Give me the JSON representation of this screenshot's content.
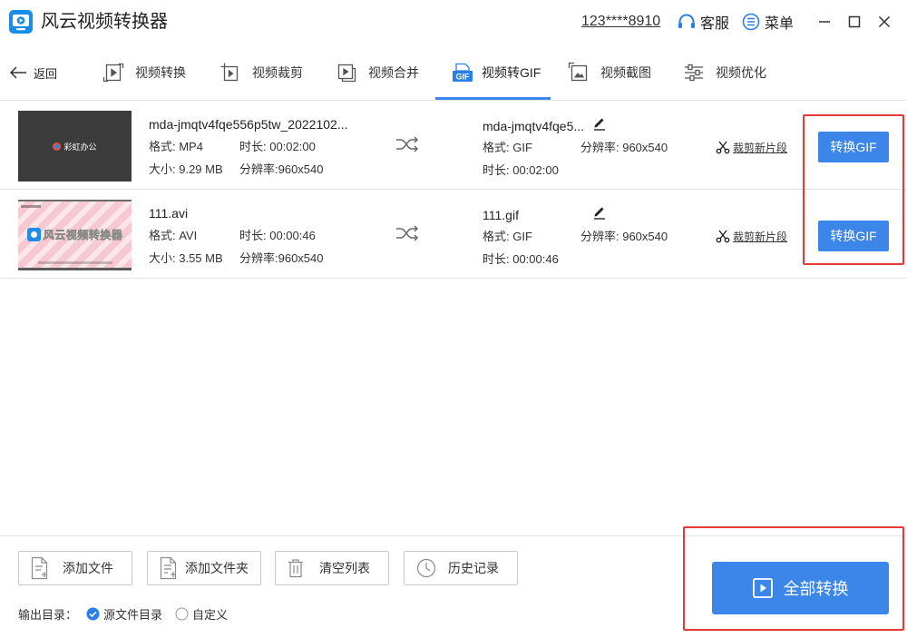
{
  "app": {
    "title": "风云视频转换器",
    "account": "123****8910",
    "support_label": "客服",
    "menu_label": "菜单"
  },
  "nav": {
    "back_label": "返回",
    "tabs": [
      {
        "label": "视频转换",
        "icon": "video-convert-icon"
      },
      {
        "label": "视频裁剪",
        "icon": "video-crop-icon"
      },
      {
        "label": "视频合并",
        "icon": "video-merge-icon"
      },
      {
        "label": "视频转GIF",
        "icon": "video-to-gif-icon",
        "badge": "GIF",
        "active": true
      },
      {
        "label": "视频截图",
        "icon": "video-screenshot-icon"
      },
      {
        "label": "视频优化",
        "icon": "video-optimize-icon"
      }
    ]
  },
  "files": [
    {
      "thumbnail": {
        "caption": "彩虹办公",
        "color": "#3c3c3c"
      },
      "name": "mda-jmqtv4fqe556p5tw_2022102...",
      "format": "格式: MP4",
      "duration": "时长: 00:02:00",
      "size": "大小: 9.29 MB",
      "resolution": "分辨率:960x540",
      "output": {
        "name": "mda-jmqtv4fqe5...",
        "format": "格式: GIF",
        "resolution": "分辨率: 960x540",
        "duration": "时长: 00:02:00"
      },
      "crop_label": "裁剪新片段",
      "convert_label": "转换GIF"
    },
    {
      "thumbnail": {
        "caption": "风云视频转换器",
        "color": "#f6c8d1"
      },
      "name": "111.avi",
      "format": "格式: AVI",
      "duration": "时长: 00:00:46",
      "size": "大小: 3.55 MB",
      "resolution": "分辨率:960x540",
      "output": {
        "name": "111.gif",
        "format": "格式: GIF",
        "resolution": "分辨率: 960x540",
        "duration": "时长: 00:00:46"
      },
      "crop_label": "裁剪新片段",
      "convert_label": "转换GIF"
    }
  ],
  "toolbar": {
    "add_file": "添加文件",
    "add_folder": "添加文件夹",
    "clear_list": "清空列表",
    "history": "历史记录"
  },
  "output_dir": {
    "label": "输出目录：",
    "options": [
      {
        "label": "源文件目录",
        "checked": true
      },
      {
        "label": "自定义",
        "checked": false
      }
    ]
  },
  "convert_all_label": "全部转换",
  "colors": {
    "accent": "#3b86e8",
    "annotation": "#e53a35"
  }
}
